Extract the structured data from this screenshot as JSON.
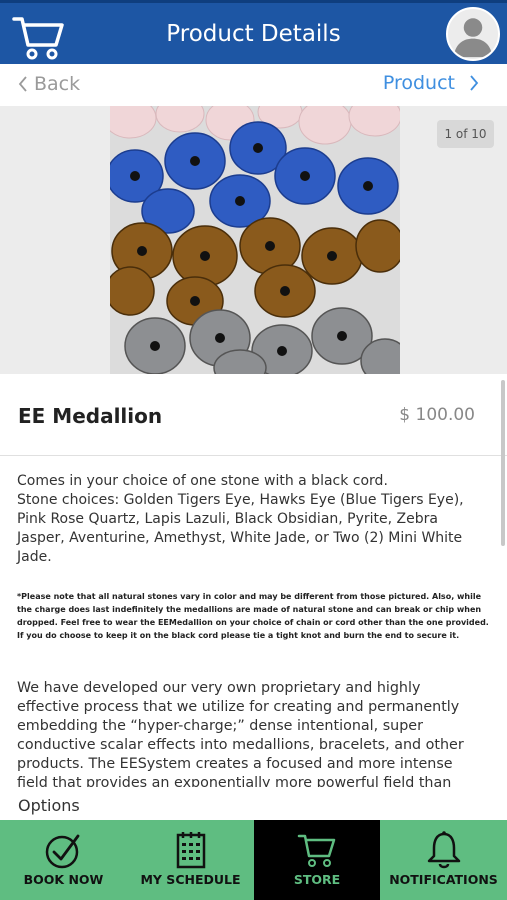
{
  "header": {
    "title": "Product Details"
  },
  "nav": {
    "back_label": "Back",
    "product_label": "Product"
  },
  "gallery": {
    "counter": "1 of 10"
  },
  "product": {
    "name": "EE Medallion",
    "price": "$ 100.00"
  },
  "description": {
    "line1": "Comes in your choice of one stone with a black cord.",
    "line2": "Stone choices: Golden Tigers Eye, Hawks Eye (Blue Tigers Eye), Pink Rose Quartz, Lapis Lazuli, Black Obsidian, Pyrite, Zebra Jasper, Aventurine, Amethyst, White Jade, or Two (2) Mini White Jade.",
    "note": "*Please note that all natural stones vary in color and may be different from those pictured. Also, while the charge does last indefinitely the medallions are made of natural stone and can break or chip when dropped. Feel free to wear the EEMedallion on your choice of chain or cord other than the one provided. If you do choose to keep it on the black cord please tie a tight knot and burn the end to secure it.",
    "paragraph": "We have developed our very own proprietary and highly effective process that we utilize for creating and permanently embedding the “hyper-charge;” dense intentional, super conductive scalar effects into medallions, bracelets, and other products. The EESystem creates a focused and more intense field that provides an exponentially more powerful field than"
  },
  "options_label": "Options",
  "tabs": [
    {
      "label": "BOOK NOW",
      "icon": "check-circle-icon"
    },
    {
      "label": "MY SCHEDULE",
      "icon": "calendar-icon"
    },
    {
      "label": "STORE",
      "icon": "cart-icon"
    },
    {
      "label": "NOTIFICATIONS",
      "icon": "bell-icon"
    }
  ],
  "colors": {
    "header": "#1d56a4",
    "tab_bar": "#5fbd81",
    "active_tab": "#000000",
    "link": "#3f8fe0"
  }
}
